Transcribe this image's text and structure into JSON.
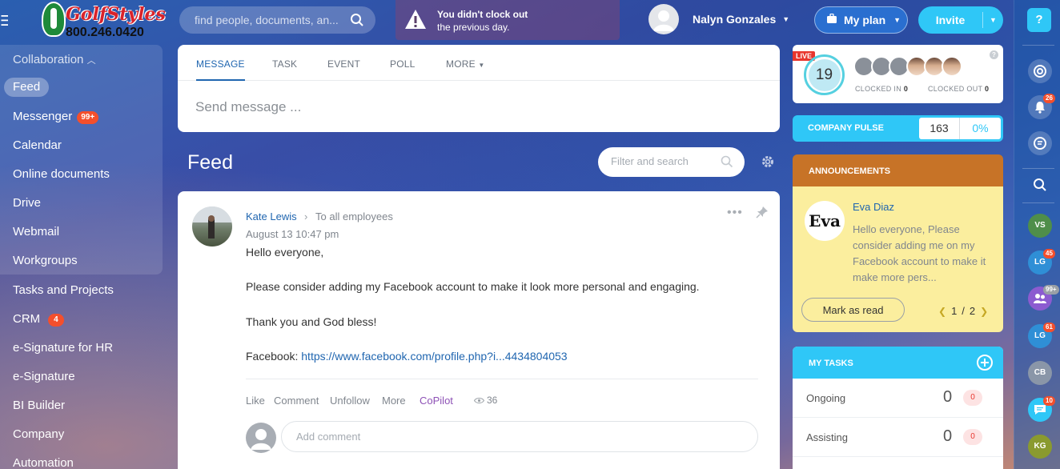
{
  "brand": {
    "logo_text": "GolfStyles",
    "phone": "800.246.0420"
  },
  "header": {
    "search_placeholder": "find people, documents, an...",
    "warning_line1": "You didn't clock out",
    "warning_line2": "the previous day.",
    "user_name": "Nalyn Gonzales",
    "myplan_label": "My plan",
    "invite_label": "Invite"
  },
  "sidebar": {
    "group_label": "Collaboration",
    "items": [
      {
        "label": "Feed",
        "active": true
      },
      {
        "label": "Messenger",
        "badge": "99+"
      },
      {
        "label": "Calendar"
      },
      {
        "label": "Online documents"
      },
      {
        "label": "Drive"
      },
      {
        "label": "Webmail"
      },
      {
        "label": "Workgroups"
      },
      {
        "label": "Tasks and Projects"
      },
      {
        "label": "CRM",
        "badge": "4"
      },
      {
        "label": "e-Signature for HR"
      },
      {
        "label": "e-Signature"
      },
      {
        "label": "BI Builder"
      },
      {
        "label": "Company"
      },
      {
        "label": "Automation"
      }
    ]
  },
  "composer": {
    "tabs": [
      "MESSAGE",
      "TASK",
      "EVENT",
      "POLL",
      "MORE"
    ],
    "placeholder": "Send message ..."
  },
  "feed": {
    "title": "Feed",
    "filter_placeholder": "Filter and search"
  },
  "post": {
    "author": "Kate Lewis",
    "recipient": "To all employees",
    "date": "August 13 10:47 pm",
    "lines": [
      "Hello everyone,",
      "Please consider adding my Facebook account to make it look more personal and engaging.",
      "Thank you and God bless!"
    ],
    "facebook_label": "Facebook:",
    "facebook_link": "https://www.facebook.com/profile.php?i...4434804053",
    "actions": [
      "Like",
      "Comment",
      "Unfollow",
      "More",
      "CoPilot"
    ],
    "views": "36",
    "comment_placeholder": "Add comment"
  },
  "clock": {
    "live": "LIVE",
    "count": "19",
    "clocked_in_label": "CLOCKED IN",
    "clocked_in_count": "0",
    "clocked_out_label": "CLOCKED OUT",
    "clocked_out_count": "0",
    "help": "?"
  },
  "pulse": {
    "label": "COMPANY PULSE",
    "value": "163",
    "percent": "0%"
  },
  "announcements": {
    "title": "ANNOUNCEMENTS",
    "avatar_text": "Eva",
    "author": "Eva Diaz",
    "text": "Hello everyone, Please consider adding me on my Facebook account to make it make more pers...",
    "mark_label": "Mark as read",
    "page_current": "1",
    "page_sep": "/",
    "page_total": "2"
  },
  "tasks": {
    "title": "MY TASKS",
    "rows": [
      {
        "label": "Ongoing",
        "count": "0",
        "badge": "0"
      },
      {
        "label": "Assisting",
        "count": "0",
        "badge": "0"
      }
    ]
  },
  "rail": {
    "help": "?",
    "notifications_badge": "26",
    "contacts": [
      {
        "initials": "VS",
        "color": "#4f8e4a"
      },
      {
        "initials": "LG",
        "color": "#2f8fd6",
        "badge": "45"
      },
      {
        "initials": "",
        "color": "#8c5bd0",
        "badge": "99+"
      },
      {
        "initials": "LG",
        "color": "#2f8fd6",
        "badge": "61"
      },
      {
        "initials": "CB",
        "color": "#8a96a8"
      },
      {
        "initials": "",
        "color": "#2fc7f7",
        "badge": "10"
      },
      {
        "initials": "KG",
        "color": "#8a9a2f"
      }
    ]
  }
}
